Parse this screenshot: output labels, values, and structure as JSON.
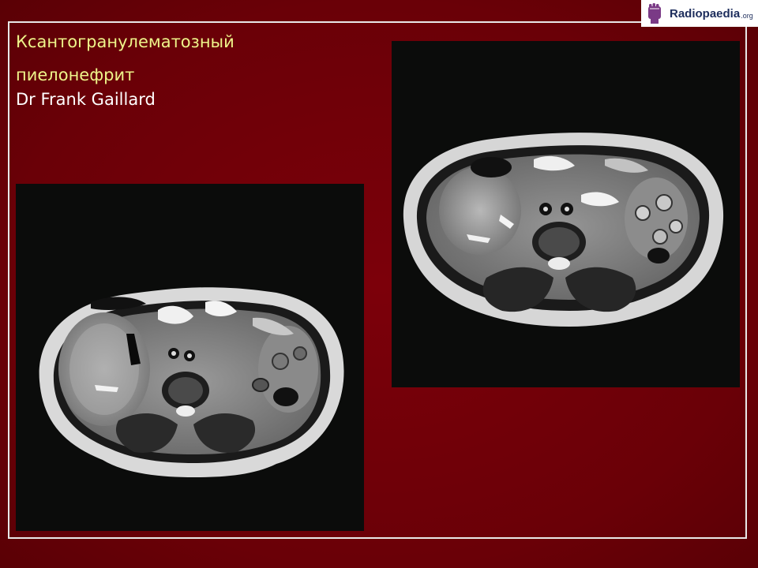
{
  "slide": {
    "title_line1": "Ксантогранулематозный",
    "title_line2": "пиелонефрит",
    "author": "Dr Frank Gaillard"
  },
  "logo": {
    "name": "Radiopaedia",
    "suffix": ".org"
  },
  "colors": {
    "background": "#6e0008",
    "title_text": "#eef58a",
    "author_text": "#ffffff",
    "frame": "#e8e8e8",
    "logo_text": "#1d2d5c",
    "logo_icon": "#7a3a86"
  },
  "images": [
    {
      "label": "axial-mri-left",
      "icon": "mri-axial-abdomen"
    },
    {
      "label": "axial-mri-right",
      "icon": "mri-axial-abdomen"
    }
  ]
}
